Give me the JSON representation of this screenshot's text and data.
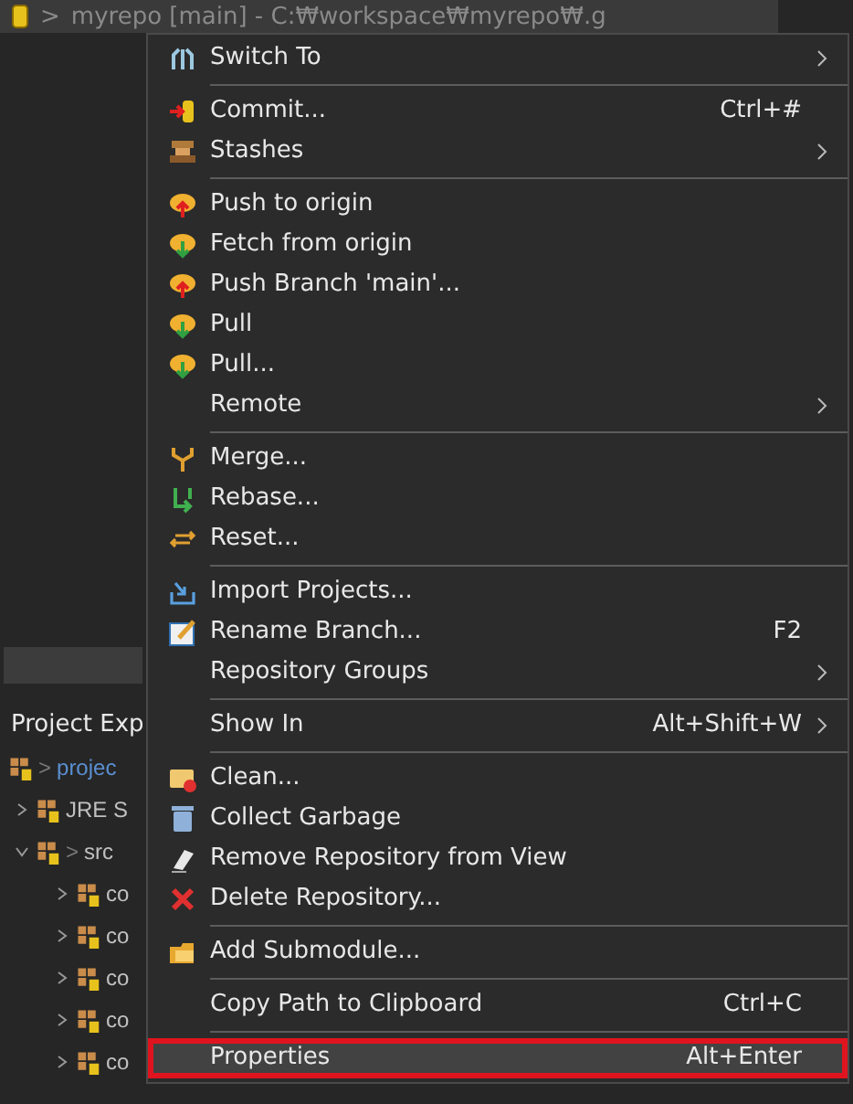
{
  "repo_row": {
    "decorator": ">",
    "label": "myrepo [main] - C:₩workspace₩myrepo₩.g"
  },
  "explorer": {
    "tab": "Project Exp",
    "tree": [
      {
        "label": "projec",
        "decorator": ">",
        "children": [
          {
            "label": "JRE S",
            "expanded": false
          },
          {
            "label": "src",
            "decorator": ">",
            "expanded": true,
            "children": [
              {
                "label": "co",
                "expanded": false
              },
              {
                "label": "co",
                "expanded": false
              },
              {
                "label": "co",
                "expanded": false
              },
              {
                "label": "co",
                "expanded": false
              },
              {
                "label": "co",
                "expanded": false
              }
            ]
          }
        ]
      }
    ]
  },
  "context_menu": {
    "groups": [
      [
        {
          "label": "Switch To",
          "submenu": true,
          "selected": false
        }
      ],
      [
        {
          "label": "Commit...",
          "shortcut": "Ctrl+#",
          "submenu": false,
          "selected": false
        },
        {
          "label": "Stashes",
          "submenu": true,
          "selected": false
        }
      ],
      [
        {
          "label": "Push to origin",
          "submenu": false,
          "selected": false
        },
        {
          "label": "Fetch from origin",
          "submenu": false,
          "selected": false
        },
        {
          "label": "Push Branch 'main'...",
          "submenu": false,
          "selected": false
        },
        {
          "label": "Pull",
          "submenu": false,
          "selected": false
        },
        {
          "label": "Pull...",
          "submenu": false,
          "selected": false
        },
        {
          "label": "Remote",
          "submenu": true,
          "selected": false
        }
      ],
      [
        {
          "label": "Merge...",
          "submenu": false,
          "selected": false
        },
        {
          "label": "Rebase...",
          "submenu": false,
          "selected": false
        },
        {
          "label": "Reset...",
          "submenu": false,
          "selected": false
        }
      ],
      [
        {
          "label": "Import Projects...",
          "submenu": false,
          "selected": false
        },
        {
          "label": "Rename Branch...",
          "shortcut": "F2",
          "submenu": false,
          "selected": false
        },
        {
          "label": "Repository Groups",
          "submenu": true,
          "selected": false
        }
      ],
      [
        {
          "label": "Show In",
          "shortcut": "Alt+Shift+W",
          "submenu": true,
          "selected": false
        }
      ],
      [
        {
          "label": "Clean...",
          "submenu": false,
          "selected": false
        },
        {
          "label": "Collect Garbage",
          "submenu": false,
          "selected": false
        },
        {
          "label": "Remove Repository from View",
          "submenu": false,
          "selected": false
        },
        {
          "label": "Delete Repository...",
          "submenu": false,
          "selected": false
        }
      ],
      [
        {
          "label": "Add Submodule...",
          "submenu": false,
          "selected": false
        }
      ],
      [
        {
          "label": "Copy Path to Clipboard",
          "shortcut": "Ctrl+C",
          "submenu": false,
          "selected": false
        }
      ],
      [
        {
          "label": "Properties",
          "shortcut": "Alt+Enter",
          "submenu": false,
          "selected": true
        }
      ]
    ]
  }
}
